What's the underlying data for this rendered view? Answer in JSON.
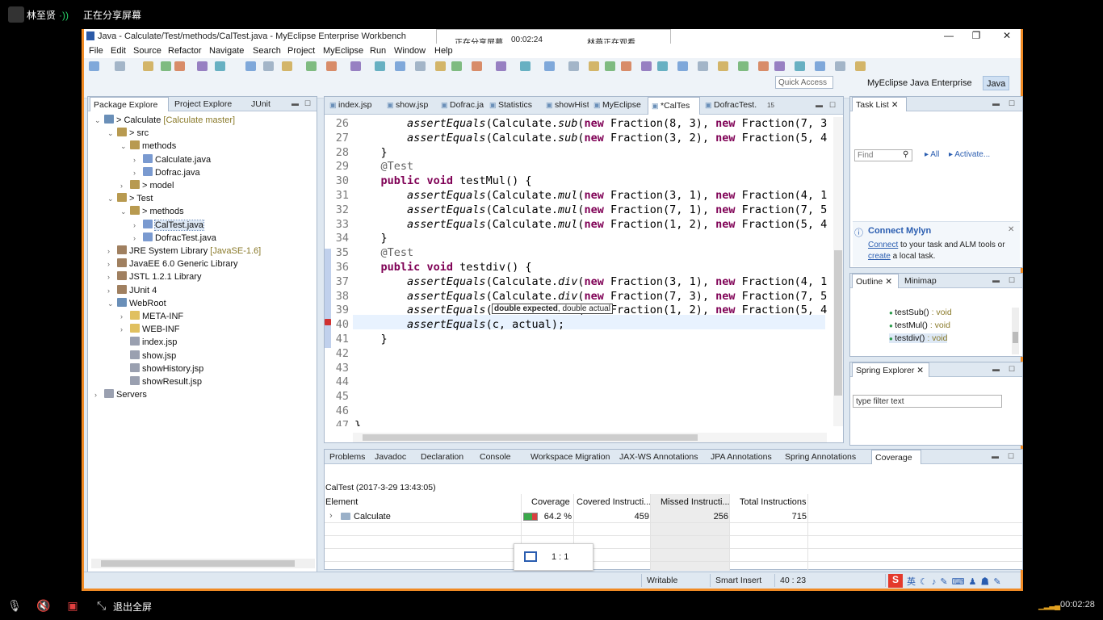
{
  "share": {
    "user_name": "林至贤",
    "sharing_label": "正在分享屏幕",
    "exit_fullscreen": "退出全屏",
    "timer": "00:02:28",
    "popup_sharing": "正在分享屏幕",
    "popup_time": "00:02:24",
    "popup_watching": "林燕正在观看"
  },
  "window": {
    "title": "Java - Calculate/Test/methods/CalTest.java - MyEclipse Enterprise Workbench",
    "minimize": "—",
    "restore": "❐",
    "close": "✕"
  },
  "menu": [
    "File",
    "Edit",
    "Source",
    "Refactor",
    "Navigate",
    "Search",
    "Project",
    "MyEclipse",
    "Run",
    "Window",
    "Help"
  ],
  "quick_access": "Quick Access",
  "perspectives": [
    "MyEclipse Java Enterprise",
    "Java"
  ],
  "left_tabs": [
    "Package Explore",
    "Project Explore",
    "JUnit"
  ],
  "tree": [
    {
      "label": "Calculate",
      "decor": "[Calculate master]",
      "prefix": "> "
    },
    {
      "label": "src",
      "prefix": "> "
    },
    {
      "label": "methods",
      "prefix": ""
    },
    {
      "label": "Calculate.java",
      "prefix": ""
    },
    {
      "label": "Dofrac.java",
      "prefix": ""
    },
    {
      "label": "model",
      "prefix": "> "
    },
    {
      "label": "Test",
      "prefix": "> "
    },
    {
      "label": "methods",
      "prefix": "> "
    },
    {
      "label": "CalTest.java",
      "prefix": ""
    },
    {
      "label": "DofracTest.java",
      "prefix": ""
    },
    {
      "label": "JRE System Library",
      "decor": "[JavaSE-1.6]",
      "prefix": ""
    },
    {
      "label": "JavaEE 6.0 Generic Library",
      "prefix": ""
    },
    {
      "label": "JSTL 1.2.1 Library",
      "prefix": ""
    },
    {
      "label": "JUnit 4",
      "prefix": ""
    },
    {
      "label": "WebRoot",
      "prefix": ""
    },
    {
      "label": "META-INF",
      "prefix": ""
    },
    {
      "label": "WEB-INF",
      "prefix": ""
    },
    {
      "label": "index.jsp",
      "prefix": ""
    },
    {
      "label": "show.jsp",
      "prefix": ""
    },
    {
      "label": "showHistory.jsp",
      "prefix": ""
    },
    {
      "label": "showResult.jsp",
      "prefix": ""
    },
    {
      "label": "Servers",
      "prefix": ""
    }
  ],
  "editor_tabs": [
    "index.jsp",
    "show.jsp",
    "Dofrac.ja",
    "Statistics",
    "showHistor",
    "MyEclipse",
    "*CalTes",
    "DofracTest."
  ],
  "editor_overflow": "15",
  "code_lines": [
    {
      "n": "26",
      "code": "        assertEquals(Calculate.sub(new Fraction(8, 3), new Fraction(7, 3"
    },
    {
      "n": "27",
      "code": "        assertEquals(Calculate.sub(new Fraction(3, 2), new Fraction(5, 4"
    },
    {
      "n": "28",
      "code": "    }"
    },
    {
      "n": "29",
      "code": "    @Test"
    },
    {
      "n": "30",
      "code": "    public void testMul() {"
    },
    {
      "n": "31",
      "code": "        assertEquals(Calculate.mul(new Fraction(3, 1), new Fraction(4, 1"
    },
    {
      "n": "32",
      "code": "        assertEquals(Calculate.mul(new Fraction(7, 1), new Fraction(7, 5"
    },
    {
      "n": "33",
      "code": "        assertEquals(Calculate.mul(new Fraction(1, 2), new Fraction(5, 4"
    },
    {
      "n": "34",
      "code": "    }"
    },
    {
      "n": "35",
      "code": "    @Test"
    },
    {
      "n": "36",
      "code": "    public void testdiv() {"
    },
    {
      "n": "37",
      "code": "        assertEquals(Calculate.div(new Fraction(3, 1), new Fraction(4, 1"
    },
    {
      "n": "38",
      "code": "        assertEquals(Calculate.div(new Fraction(7, 3), new Fraction(7, 5"
    },
    {
      "n": "39",
      "code": "        assertEquals(Calculate.div(new Fraction(1, 2), new Fraction(5, 4"
    },
    {
      "n": "40",
      "code": "        assertEquals(c, actual);"
    },
    {
      "n": "41",
      "code": "    }"
    },
    {
      "n": "42",
      "code": ""
    },
    {
      "n": "43",
      "code": ""
    },
    {
      "n": "44",
      "code": ""
    },
    {
      "n": "45",
      "code": ""
    },
    {
      "n": "46",
      "code": ""
    },
    {
      "n": "47",
      "code": "}"
    }
  ],
  "tooltip": {
    "bold": "double expected",
    "rest": ", double actual"
  },
  "task_list": {
    "tab": "Task List",
    "find_placeholder": "Find",
    "all": "All",
    "activate": "Activate..."
  },
  "mylyn": {
    "title": "Connect Mylyn",
    "link1": "Connect",
    "text1": " to your task and ALM tools or",
    "link2": "create",
    "text2": " a local task."
  },
  "outline": {
    "tabs": [
      "Outline",
      "Minimap"
    ],
    "items": [
      {
        "name": "testSub()",
        "type": " : void"
      },
      {
        "name": "testMul()",
        "type": " : void"
      },
      {
        "name": "testdiv()",
        "type": " : void"
      }
    ]
  },
  "spring": {
    "tab": "Spring Explorer",
    "filter_placeholder": "type filter text"
  },
  "bottom_tabs": [
    "Problems",
    "Javadoc",
    "Declaration",
    "Console",
    "Workspace Migration",
    "JAX-WS Annotations",
    "JPA Annotations",
    "Spring Annotations",
    "Coverage"
  ],
  "coverage": {
    "session": "CalTest (2017-3-29 13:43:05)",
    "columns": [
      "Element",
      "Coverage",
      "Covered Instructi...",
      "Missed Instructi...",
      "Total Instructions"
    ],
    "row": {
      "element": "Calculate",
      "coverage": "64.2 %",
      "covered": "459",
      "missed": "256",
      "total": "715"
    },
    "coverage_fraction": 0.642
  },
  "zoom_label": "1 : 1",
  "status": {
    "writable": "Writable",
    "insert": "Smart Insert",
    "position": "40 : 23"
  },
  "colors": {
    "frame": "#f08a24",
    "keyword": "#7f0055",
    "annotation": "#646464",
    "link": "#2a5db0"
  }
}
